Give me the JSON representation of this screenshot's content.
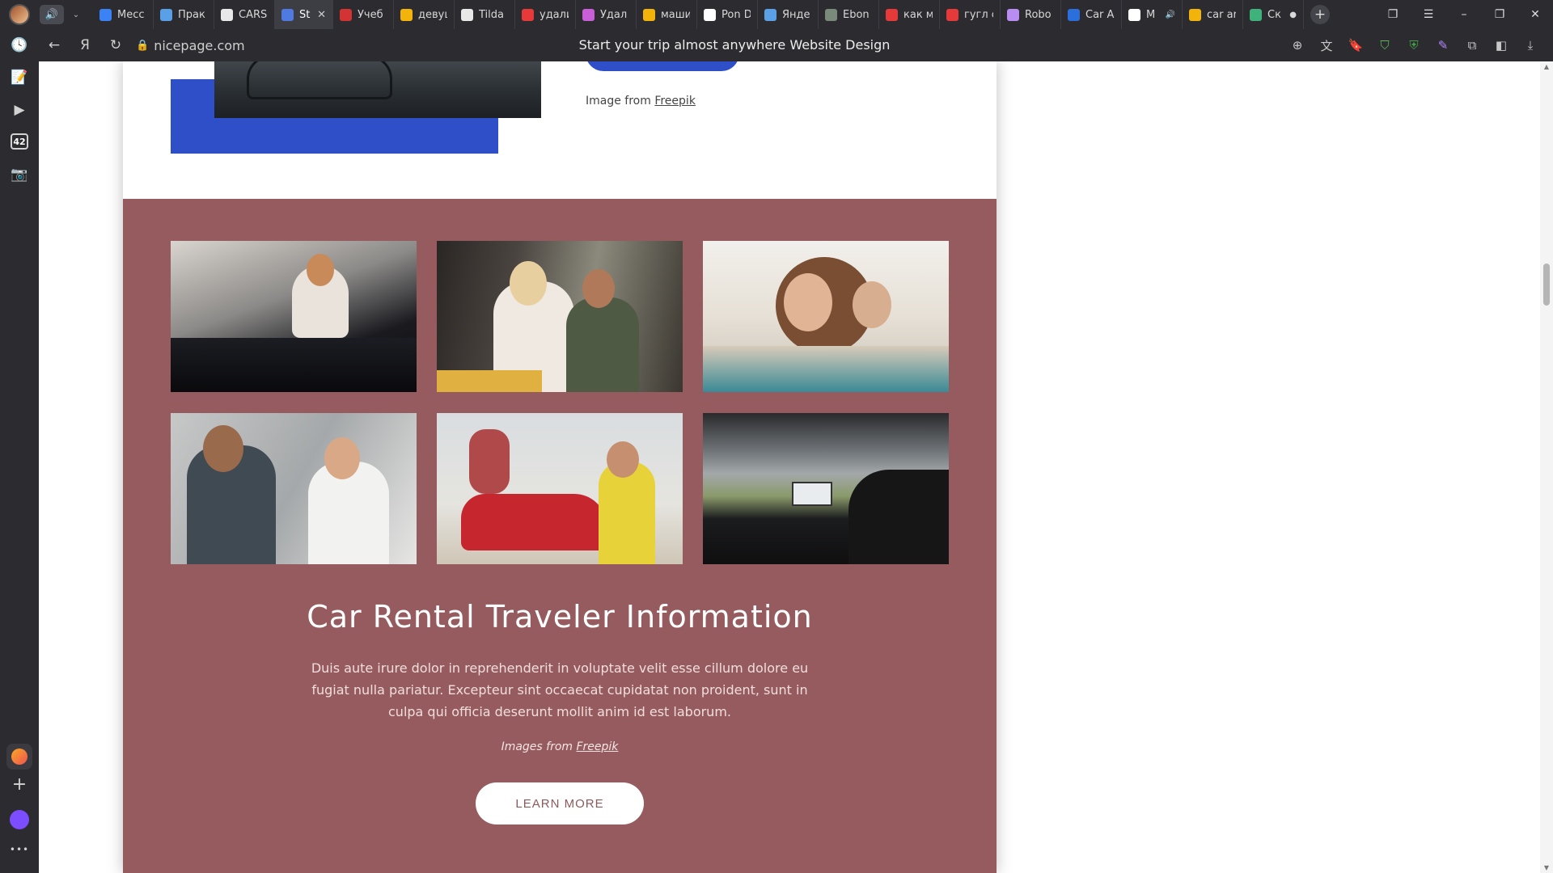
{
  "browser": {
    "tabs": [
      {
        "label": "Месс",
        "color": "#3b82f6",
        "icon": "chat-icon"
      },
      {
        "label": "Прак",
        "color": "#5aa0e6",
        "icon": "paper-plane-icon"
      },
      {
        "label": "CARS",
        "color": "#e8e8e8",
        "icon": "document-icon"
      },
      {
        "label": "St",
        "color": "#4f7be0",
        "icon": "p-logo-icon",
        "active": true
      },
      {
        "label": "Учеб",
        "color": "#d33333",
        "icon": "book-icon"
      },
      {
        "label": "девуш",
        "color": "#f2b30a",
        "icon": "image-icon"
      },
      {
        "label": "Tilda",
        "color": "#e8e8e8",
        "icon": "tilda-icon"
      },
      {
        "label": "удали",
        "color": "#e63939",
        "icon": "yandex-icon"
      },
      {
        "label": "Удал",
        "color": "#c95fd8",
        "icon": "swirl-icon"
      },
      {
        "label": "маши",
        "color": "#f2b30a",
        "icon": "image-icon"
      },
      {
        "label": "Pon D",
        "color": "#ffffff",
        "icon": "play-icon"
      },
      {
        "label": "Янде",
        "color": "#5aa0e6",
        "icon": "paper-plane-icon"
      },
      {
        "label": "Ebon",
        "color": "#7a8a7a",
        "icon": "square-icon"
      },
      {
        "label": "как м",
        "color": "#e63939",
        "icon": "yandex-icon"
      },
      {
        "label": "гугл с",
        "color": "#e63939",
        "icon": "yandex-icon"
      },
      {
        "label": "Robo",
        "color": "#b88cf0",
        "icon": "robot-icon"
      },
      {
        "label": "Car A",
        "color": "#2a6fdb",
        "icon": "globe-icon"
      },
      {
        "label": "М",
        "color": "#ffffff",
        "icon": "play-icon",
        "audio": "🔊"
      },
      {
        "label": "car ar",
        "color": "#f2b30a",
        "icon": "image-icon"
      },
      {
        "label": "Cк",
        "color": "#3fb17a",
        "icon": "chart-icon",
        "dot": "●"
      }
    ],
    "tab_close": "✕",
    "new_tab": "+",
    "sound_icon": "🔊",
    "tabs_dropdown": "⌄",
    "window_controls": {
      "tabs_menu": "❐",
      "menu": "☰",
      "minimize": "–",
      "restore": "❐",
      "close": "✕"
    },
    "domain": "nicepage.com",
    "lock_icon": "🔒",
    "page_title": "Start your trip almost anywhere Website Design",
    "nav": {
      "back": "←",
      "yandex": "Я",
      "reload": "↻"
    },
    "addr_icons": {
      "zoom": "⊕",
      "translate": "文",
      "bookmark": "🔖",
      "ext1": "⛉",
      "ext2": "⛨",
      "ext3": "✎",
      "collections": "⧉",
      "ext4": "◧",
      "download": "⤓"
    },
    "sidebar": {
      "history": "🕓",
      "notes": "📝",
      "video": "▶",
      "badge": "42",
      "screenshot": "📷",
      "add": "+",
      "more": "•••"
    }
  },
  "page": {
    "top_image_credit_prefix": "Image from ",
    "top_image_credit_link": "Freepik",
    "section_title": "Car Rental Traveler Information",
    "section_text": "Duis aute irure dolor in reprehenderit in voluptate velit esse cillum dolore eu fugiat nulla pariatur. Excepteur sint occaecat cupidatat non proident, sunt in culpa qui officia deserunt mollit anim id est laborum.",
    "images_credit_prefix": "Images from ",
    "images_credit_link": "Freepik",
    "learn_more": "LEARN MORE",
    "colors": {
      "section_bg": "#965b5e",
      "accent_blue": "#2f4fc9"
    }
  }
}
